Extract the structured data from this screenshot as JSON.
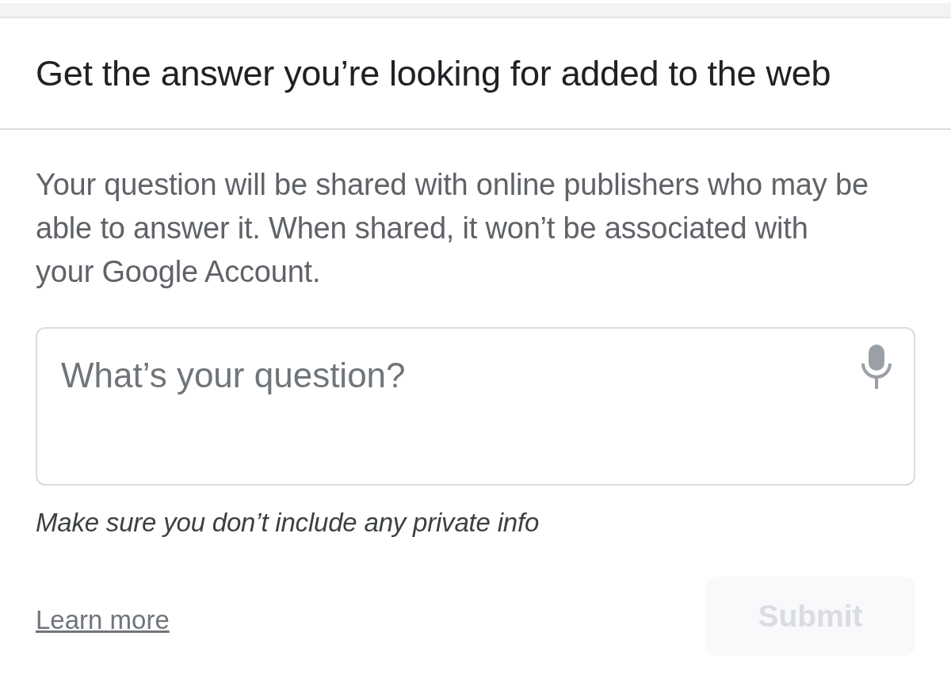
{
  "dialog": {
    "title": "Get the answer you’re looking for added to the web",
    "description": "Your question will be shared with online publishers who may be able to answer it. When shared, it won’t be associated with your Google Account.",
    "question_field": {
      "placeholder": "What’s your question?"
    },
    "hint": "Make sure you don’t include any private info",
    "learn_more_link": "Learn more",
    "submit_button": {
      "label": "Submit",
      "disabled": true
    }
  }
}
